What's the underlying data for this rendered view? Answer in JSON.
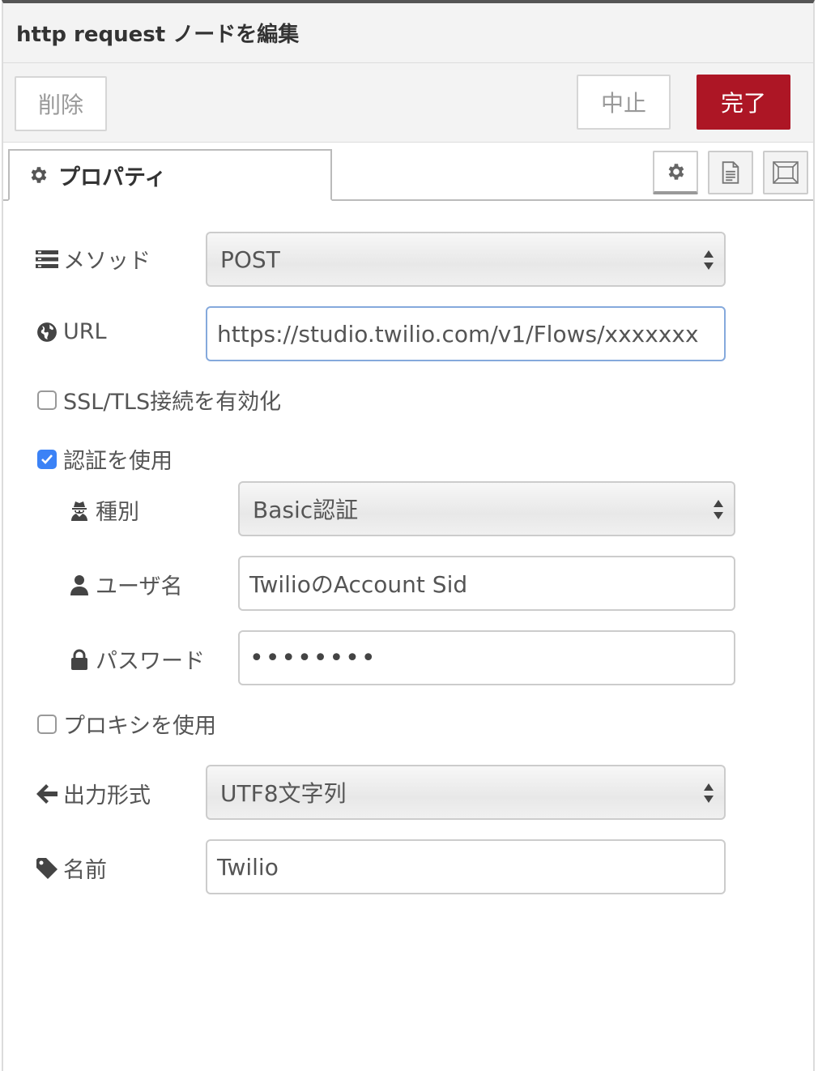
{
  "header": {
    "title": "http request ノードを編集"
  },
  "toolbar": {
    "delete_label": "削除",
    "cancel_label": "中止",
    "done_label": "完了"
  },
  "tabs": {
    "properties_label": "プロパティ"
  },
  "form": {
    "method": {
      "label": "メソッド",
      "value": "POST"
    },
    "url": {
      "label": "URL",
      "value": "https://studio.twilio.com/v1/Flows/xxxxxxx"
    },
    "ssl": {
      "label": "SSL/TLS接続を有効化",
      "checked": false
    },
    "auth": {
      "label": "認証を使用",
      "checked": true
    },
    "auth_type": {
      "label": "種別",
      "value": "Basic認証"
    },
    "username": {
      "label": "ユーザ名",
      "value": "TwilioのAccount Sid"
    },
    "password": {
      "label": "パスワード",
      "value": "••••••••"
    },
    "proxy": {
      "label": "プロキシを使用",
      "checked": false
    },
    "output": {
      "label": "出力形式",
      "value": "UTF8文字列"
    },
    "name": {
      "label": "名前",
      "value": "Twilio"
    }
  },
  "colors": {
    "done_button": "#ad1625",
    "checkbox_checked": "#3b82f6",
    "focus_border": "#85a9dc"
  }
}
